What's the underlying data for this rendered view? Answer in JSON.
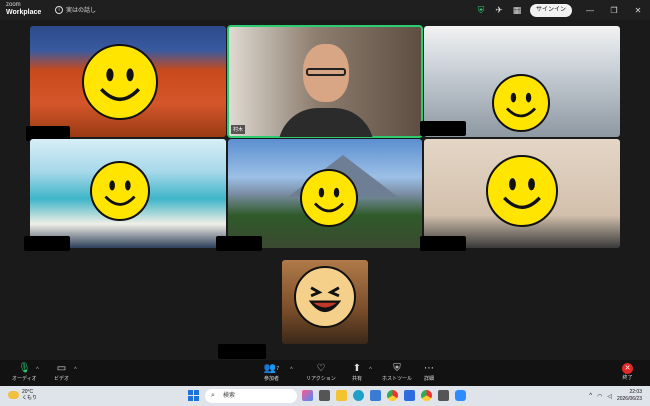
{
  "titlebar": {
    "logo_small": "zoom",
    "logo_big": "Workplace",
    "info_text": "実はの話し",
    "signin_label": "サインイン"
  },
  "tiles": [
    {
      "name": "",
      "active": false,
      "bg": "#c44a1a"
    },
    {
      "name": "村木",
      "active": true,
      "bg": "#6b5a4a"
    },
    {
      "name": "",
      "active": false,
      "bg": "#a8b0b8"
    },
    {
      "name": "",
      "active": false,
      "bg": "#4fa8c4"
    },
    {
      "name": "",
      "active": false,
      "bg": "#6c8fb8"
    },
    {
      "name": "",
      "active": false,
      "bg": "#c7b7a4"
    },
    {
      "name": "",
      "active": false,
      "bg": "#8a5a36"
    }
  ],
  "toolbar": {
    "audio_label": "オーディオ",
    "video_label": "ビデオ",
    "participants_label": "参加者",
    "participants_count": "7",
    "reactions_label": "リアクション",
    "share_label": "共有",
    "host_tools_label": "ホストツール",
    "more_label": "詳細",
    "end_label": "終了"
  },
  "taskbar": {
    "weather_temp": "20°C",
    "weather_desc": "くもり",
    "search_placeholder": "検索",
    "time": "22:03",
    "date": "2026/06/23"
  },
  "colors": {
    "active_border": "#2ecc71",
    "end_red": "#e02828",
    "smiley_yellow": "#ffe500"
  }
}
